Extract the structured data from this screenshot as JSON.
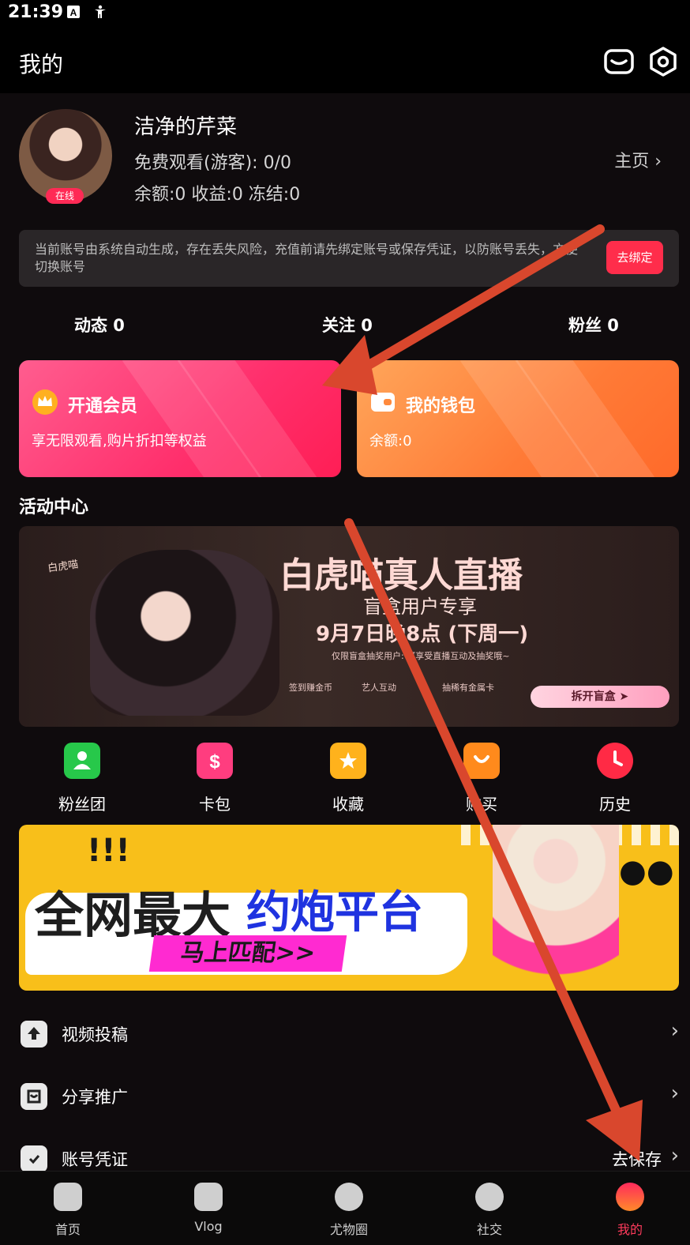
{
  "status_bar": {
    "time": "21:39"
  },
  "header": {
    "title": "我的"
  },
  "profile": {
    "username": "洁净的芹菜",
    "online_badge": "在线",
    "free_watch": "免费观看(游客): 0/0",
    "balances": "余额:0 收益:0 冻结:0",
    "homepage_link": "主页 ›"
  },
  "notice": {
    "text": "当前账号由系统自动生成，存在丢失风险，充值前请先绑定账号或保存凭证，以防账号丢失，方便切换账号",
    "bind_button": "去绑定"
  },
  "stats": [
    {
      "label": "动态 0"
    },
    {
      "label": "关注 0"
    },
    {
      "label": "粉丝 0"
    }
  ],
  "cards": {
    "vip": {
      "title": "开通会员",
      "subtitle": "享无限观看,购片折扣等权益"
    },
    "wallet": {
      "title": "我的钱包",
      "subtitle": "余额:0"
    }
  },
  "activity": {
    "section_title": "活动中心",
    "banner1": {
      "title": "白虎喵真人直播",
      "subtitle": "盲盒用户专享",
      "date": "9月7日晚8点 (下周一)",
      "note": "仅限盲盒抽奖用户: 可享受直播互动及抽奖哦~",
      "mini1": "签到赚金币",
      "mini2": "艺人互动",
      "mini3": "抽稀有金属卡",
      "button": "拆开盲盒 ➤",
      "hand_text": "白虎喵"
    }
  },
  "quick_actions": [
    {
      "label": "粉丝团",
      "color": "#27c84a"
    },
    {
      "label": "卡包",
      "color": "#ff3d7f"
    },
    {
      "label": "收藏",
      "color": "#ffb21c"
    },
    {
      "label": "购买",
      "color": "#ff8a1c"
    },
    {
      "label": "历史",
      "color": "#ff2a45"
    }
  ],
  "banner2": {
    "exclaim": "!!!",
    "title_a": "全网最大",
    "title_b": "约炮平台",
    "button": "马上匹配>>"
  },
  "menu": [
    {
      "label": "视频投稿",
      "extra": ""
    },
    {
      "label": "分享推广",
      "extra": ""
    },
    {
      "label": "账号凭证",
      "extra": "去保存"
    }
  ],
  "tabs": [
    {
      "label": "首页"
    },
    {
      "label": "Vlog"
    },
    {
      "label": "尤物圈"
    },
    {
      "label": "社交"
    },
    {
      "label": "我的",
      "active": true
    }
  ],
  "colors": {
    "accent": "#ff2d4b",
    "annotation_arrow": "#d9472d"
  }
}
